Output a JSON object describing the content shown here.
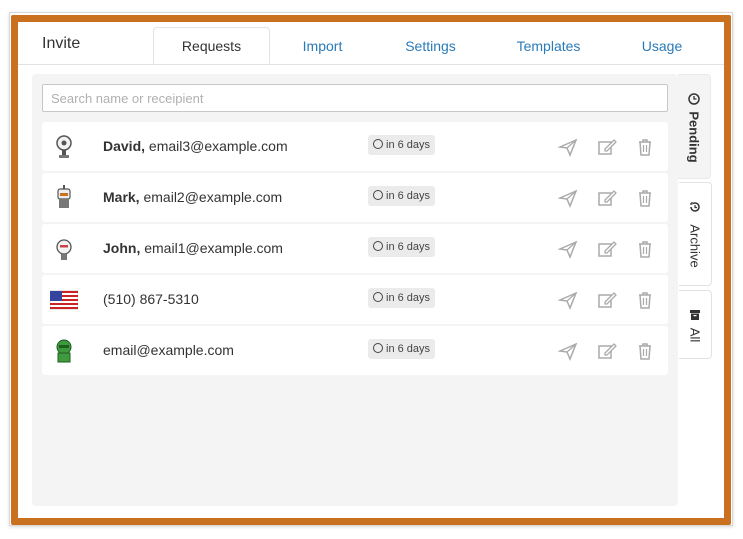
{
  "header": {
    "title": "Invite",
    "tabs": [
      {
        "label": "Requests",
        "active": true
      },
      {
        "label": "Import"
      },
      {
        "label": "Settings"
      },
      {
        "label": "Templates"
      },
      {
        "label": "Usage"
      }
    ]
  },
  "search": {
    "placeholder": "Search name or receipient",
    "value": ""
  },
  "rows": [
    {
      "name": "David,",
      "contact": "email3@example.com",
      "badge": "in 6 days",
      "avatar": "robot-avatar"
    },
    {
      "name": "Mark,",
      "contact": "email2@example.com",
      "badge": "in 6 days",
      "avatar": "robot-avatar"
    },
    {
      "name": "John,",
      "contact": "email1@example.com",
      "badge": "in 6 days",
      "avatar": "robot-avatar"
    },
    {
      "name": "",
      "contact": "(510) 867-5310",
      "badge": "in 6 days",
      "avatar": "us-flag-icon"
    },
    {
      "name": "",
      "contact": "email@example.com",
      "badge": "in 6 days",
      "avatar": "green-robot-avatar"
    }
  ],
  "side_tabs": [
    {
      "label": "Pending",
      "icon": "clock-icon",
      "active": true
    },
    {
      "label": "Archive",
      "icon": "history-icon"
    },
    {
      "label": "All",
      "icon": "archive-box-icon"
    }
  ],
  "colors": {
    "frame": "#c9711f",
    "link": "#2a7ab8"
  }
}
